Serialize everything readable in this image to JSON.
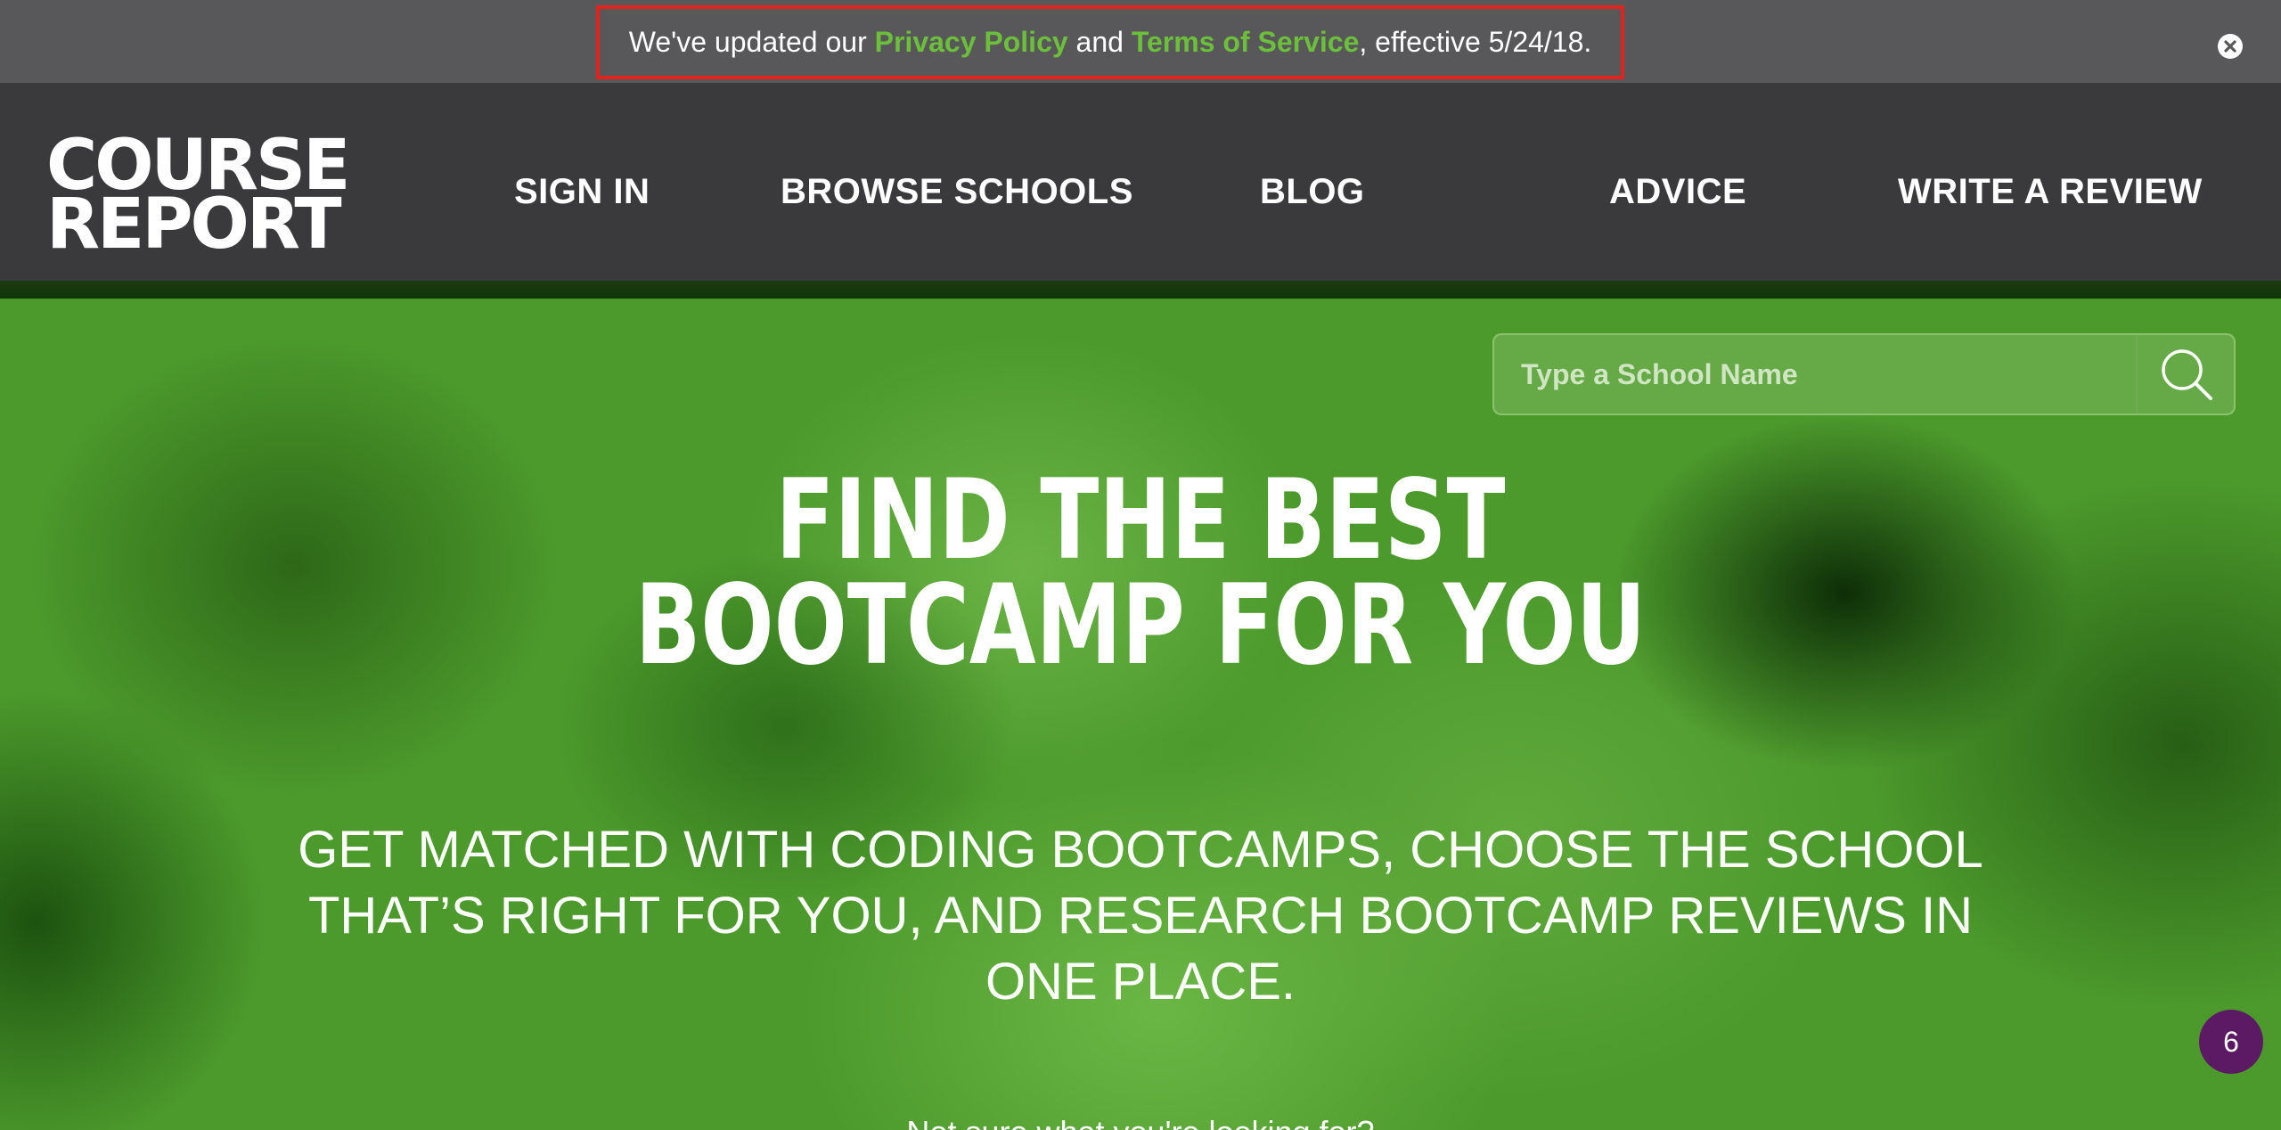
{
  "notice": {
    "prefix": "We've updated our ",
    "privacy_link": "Privacy Policy",
    "and": " and ",
    "terms_link": "Terms of Service",
    "suffix": ", effective 5/24/18.",
    "close_icon": "close-circle-icon"
  },
  "header": {
    "logo_line1": "COURSE",
    "logo_line2": "REPORT",
    "nav": [
      "SIGN IN",
      "BROWSE SCHOOLS",
      "BLOG",
      "ADVICE",
      "WRITE A REVIEW"
    ]
  },
  "hero": {
    "search_placeholder": "Type a School Name",
    "search_icon": "search-icon",
    "title_line1": "FIND THE BEST",
    "title_line2": "BOOTCAMP FOR YOU",
    "subtitle_line1": "GET MATCHED WITH CODING BOOTCAMPS, CHOOSE THE SCHOOL",
    "subtitle_line2": "THAT’S RIGHT FOR YOU, AND RESEARCH BOOTCAMP REVIEWS IN",
    "subtitle_line3": "ONE PLACE.",
    "hint": "Not sure what you're looking for?"
  },
  "chat_badge": {
    "count": "6"
  },
  "colors": {
    "accent_green": "#6cbf3b",
    "header_bg": "#3a3a3c",
    "notice_bg": "#58585a",
    "highlight_border": "#e0231d",
    "badge_purple": "#5b1a63"
  }
}
